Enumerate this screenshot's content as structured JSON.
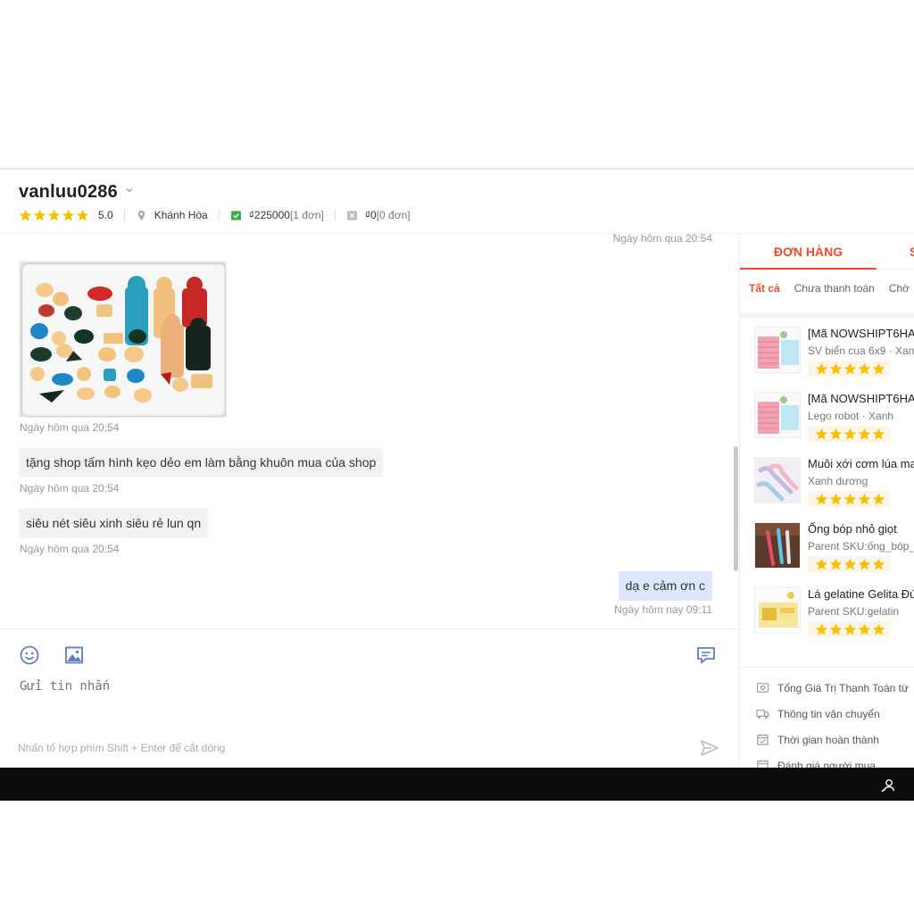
{
  "header": {
    "username": "vanluu0286",
    "rating": "5.0",
    "location": "Khánh Hòa",
    "paid_amount": "₫225000",
    "paid_orders": "[1 đơn]",
    "cancel_amount": "₫0",
    "cancel_orders": "[0 đơn]"
  },
  "chat": {
    "top_timestamp": "Ngày hôm qua 20:54",
    "image_timestamp": "Ngày hôm qua 20:54",
    "messages": [
      {
        "text": "tặng shop tấm hình kẹo dẻo em làm bằng khuôn mua của shop",
        "time": "Ngày hôm qua 20:54"
      },
      {
        "text": "siêu nét siêu xinh siêu rẻ lun qn",
        "time": "Ngày hôm qua 20:54"
      },
      {
        "text": "dạ e cảm ơn c",
        "time": "Ngày hôm nay 09:11"
      }
    ]
  },
  "composer": {
    "placeholder": "Gửi tin nhắn",
    "hint": "Nhấn tổ hợp phím Shift + Enter để cắt dòng"
  },
  "panel": {
    "tab_active": "ĐƠN HÀNG",
    "tab_next": "S",
    "filters": [
      "Tất cả",
      "Chưa thanh toán",
      "Chờ"
    ],
    "orders": [
      {
        "title": "[Mã NOWSHIPT6HA",
        "sub": "SV biển cua 6x9 · Xan"
      },
      {
        "title": "[Mã NOWSHIPT6HA",
        "sub": "Lego robot · Xanh"
      },
      {
        "title": "Muôi xới cơm lúa ma",
        "sub": "Xanh dương"
      },
      {
        "title": "Ống bóp nhỏ giọt",
        "sub": "Parent SKU:ống_bóp_"
      },
      {
        "title": "Lá gelatine Gelita Đứ",
        "sub": "Parent SKU:gelatin"
      }
    ],
    "summary": [
      {
        "label": "Tổng Giá Trị Thanh Toán từ",
        "icon": "money-icon"
      },
      {
        "label": "Thông tin vận chuyển",
        "icon": "truck-icon"
      },
      {
        "label": "Thời gian hoàn thành",
        "icon": "calendar-icon"
      },
      {
        "label": "Đánh giá người mua",
        "icon": "calendar-icon"
      }
    ]
  },
  "colors": {
    "accent": "#ee4d2d",
    "star": "#f6c000",
    "my_bubble": "#dde6ff",
    "other_bubble": "#f2f2f2",
    "icon_blue": "#5b7fc4"
  }
}
